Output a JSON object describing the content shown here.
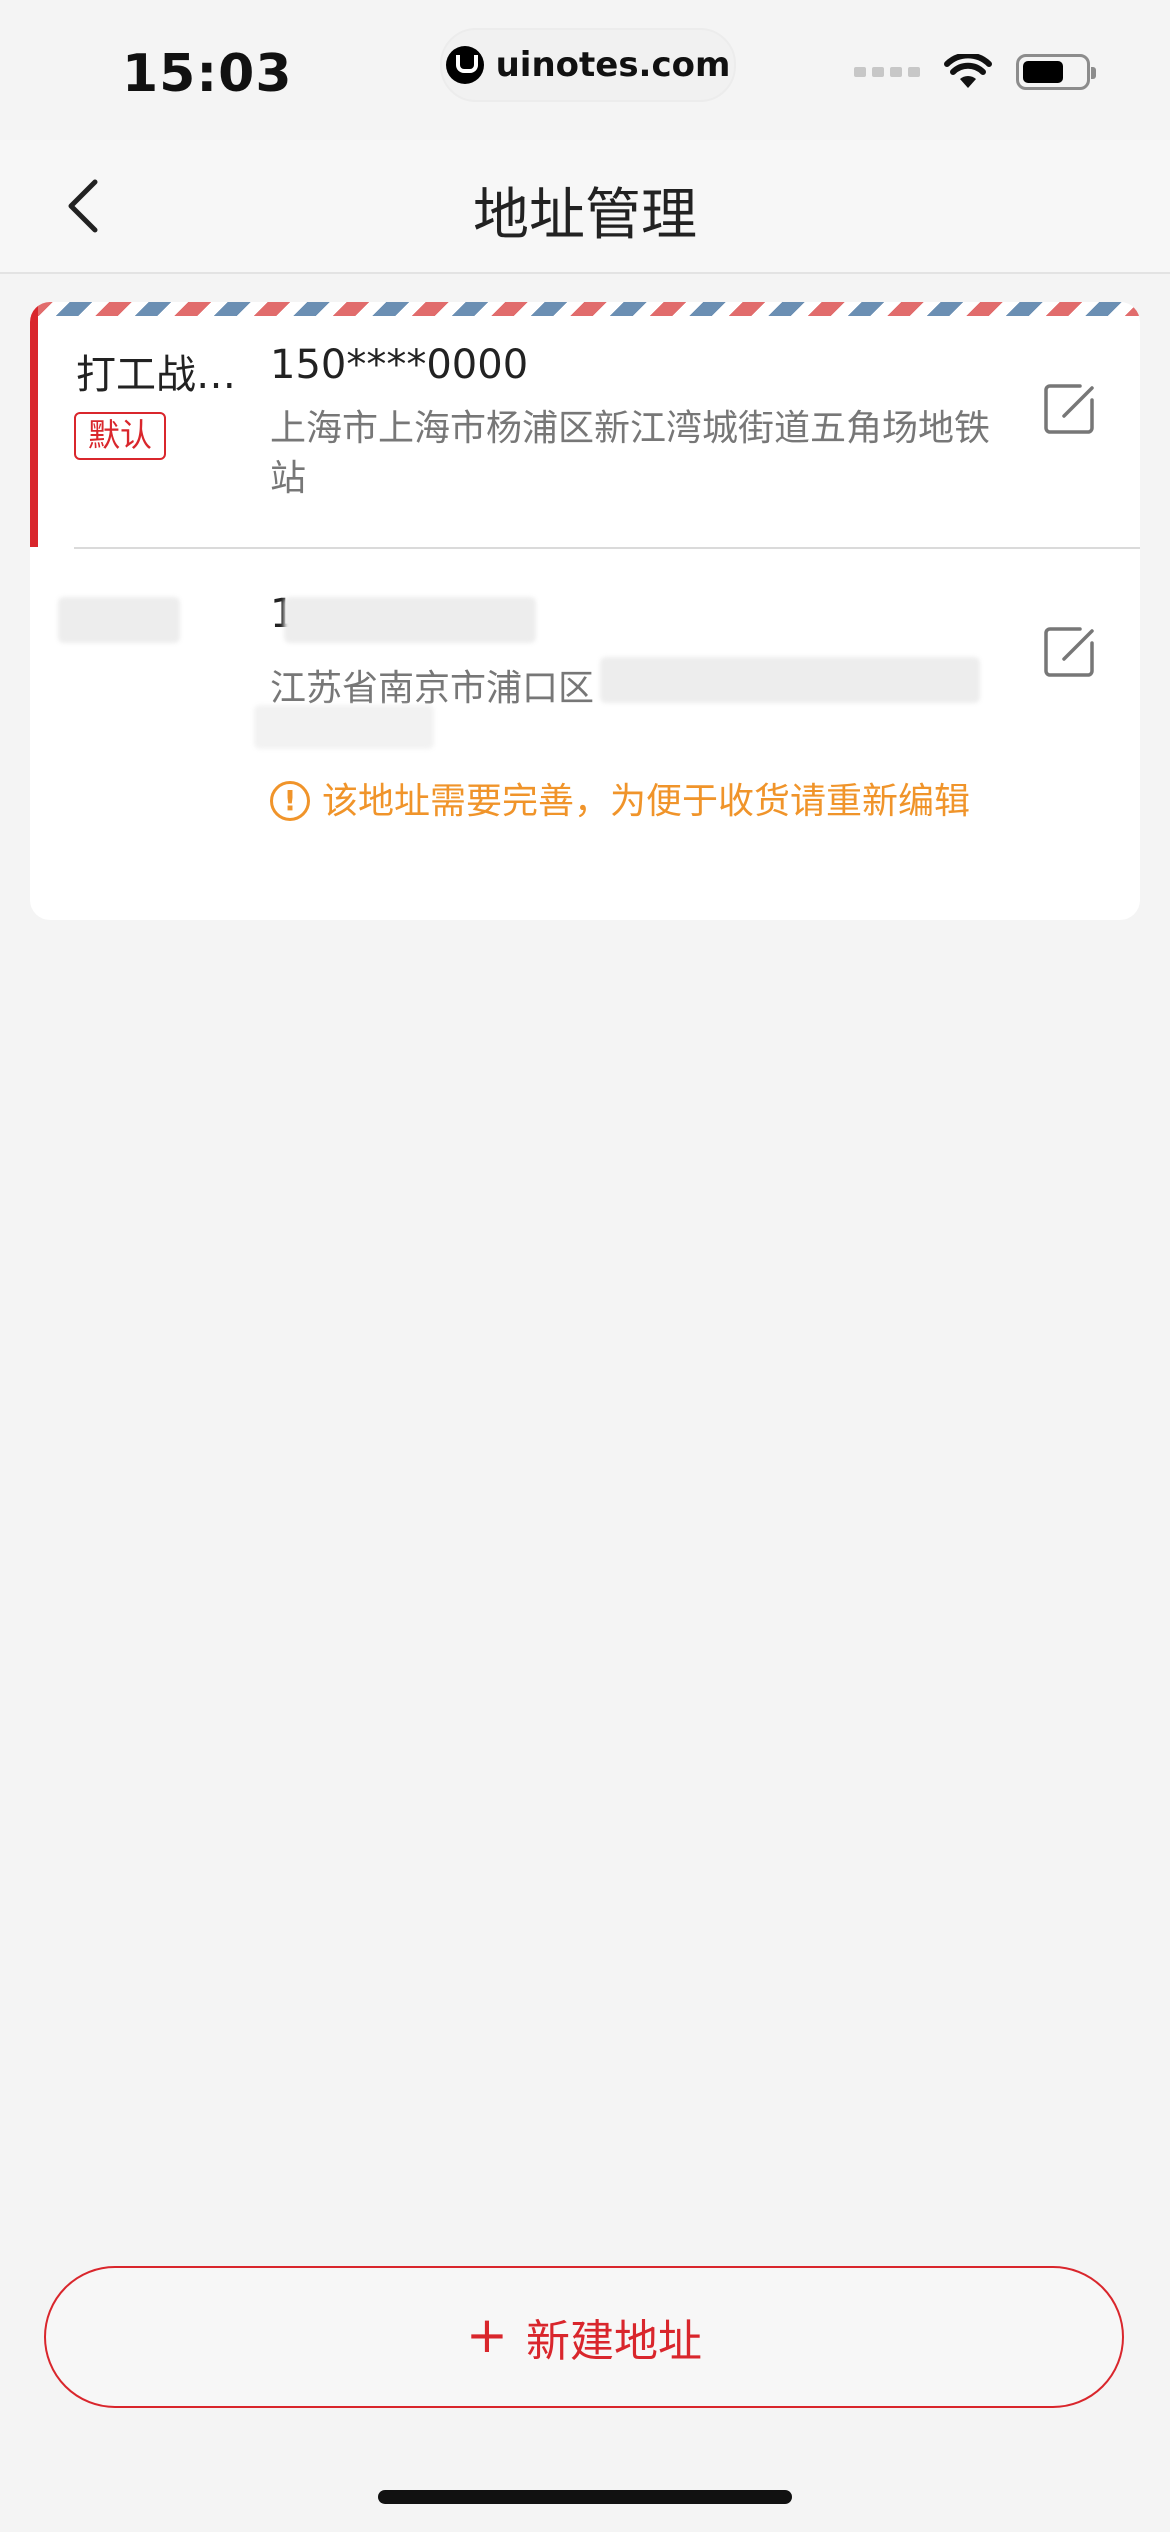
{
  "status_bar": {
    "time": "15:03",
    "site": "uinotes.com"
  },
  "header": {
    "title": "地址管理"
  },
  "addresses": [
    {
      "name": "打工战…",
      "tag": "默认",
      "phone": "150****0000",
      "address": "上海市上海市杨浦区新江湾城街道五角场地铁站"
    },
    {
      "phone": "1",
      "address": "江苏省南京市浦口区",
      "warning": "该地址需要完善，为便于收货请重新编辑"
    }
  ],
  "footer": {
    "new_address_label": "新建地址",
    "plus": "+"
  },
  "colors": {
    "accent": "#d9262c",
    "warning": "#f0942a",
    "background": "#f4f4f4"
  }
}
